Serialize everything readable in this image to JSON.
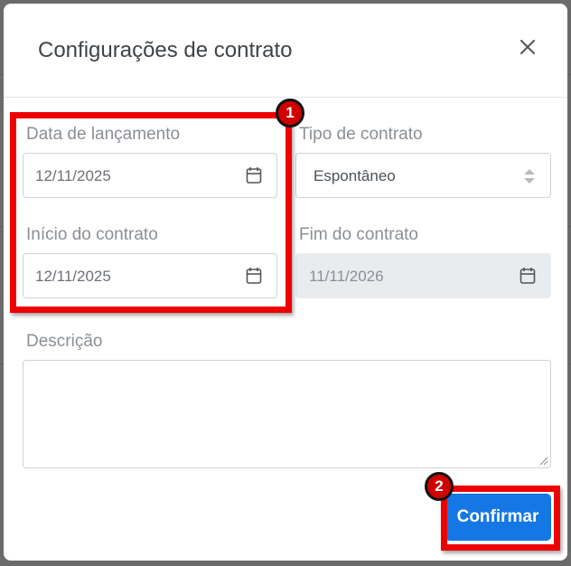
{
  "modal": {
    "title": "Configurações de contrato",
    "close_icon": "close-icon"
  },
  "form": {
    "launch_date": {
      "label": "Data de lançamento",
      "value": "12/11/2025",
      "icon": "calendar-icon"
    },
    "contract_type": {
      "label": "Tipo de contrato",
      "value": "Espontâneo",
      "icon": "sort-arrows-icon"
    },
    "start_date": {
      "label": "Início do contrato",
      "value": "12/11/2025",
      "icon": "calendar-icon"
    },
    "end_date": {
      "label": "Fim do contrato",
      "value": "11/11/2026",
      "icon": "calendar-icon",
      "disabled": true
    },
    "description": {
      "label": "Descrição",
      "value": ""
    }
  },
  "actions": {
    "confirm_label": "Confirmar"
  },
  "annotations": {
    "step1": "1",
    "step2": "2",
    "highlight_color": "#ee0000"
  },
  "colors": {
    "primary": "#1577e3",
    "label": "#8a8f94",
    "disabled_bg": "#e9ecef"
  }
}
